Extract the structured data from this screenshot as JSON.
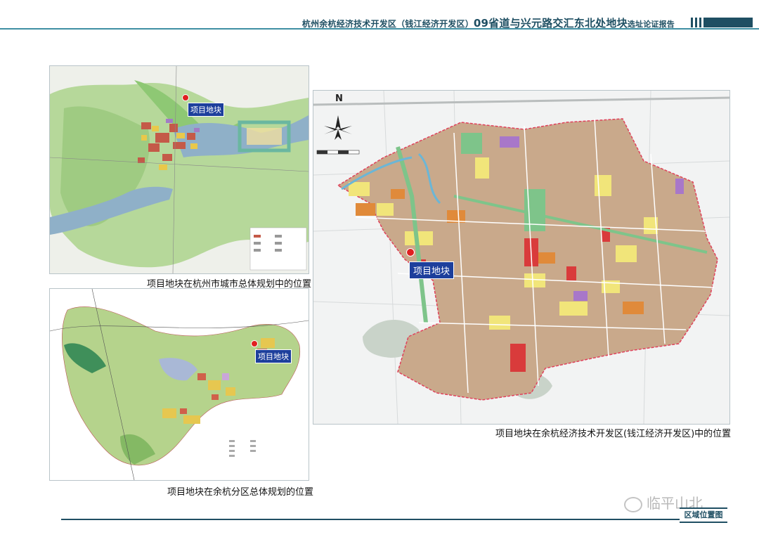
{
  "header": {
    "title_prefix": "杭州余杭经济技术开发区（钱江经济开发区）",
    "title_main": "09省道与兴元路交汇东北处地块",
    "title_suffix": "选址论证报告"
  },
  "maps": {
    "city_plan": {
      "caption": "项目地块在杭州市城市总体规划中的位置",
      "pin_label": "项目地块"
    },
    "district_plan": {
      "caption": "项目地块在余杭分区总体规划的位置",
      "pin_label": "项目地块"
    },
    "zone_plan": {
      "caption": "项目地块在余杭经济技术开发区(钱江经济开发区)中的位置",
      "pin_label": "项目地块",
      "north_label": "N"
    }
  },
  "footer": {
    "section_tag": "区域位置图",
    "watermark": "临平山北"
  },
  "colors": {
    "accent": "#1f4f63",
    "rule": "#3f8fa3",
    "pin_bg": "#1d3f9c",
    "pin_dot": "#e02020",
    "boundary": "#e0415b"
  }
}
